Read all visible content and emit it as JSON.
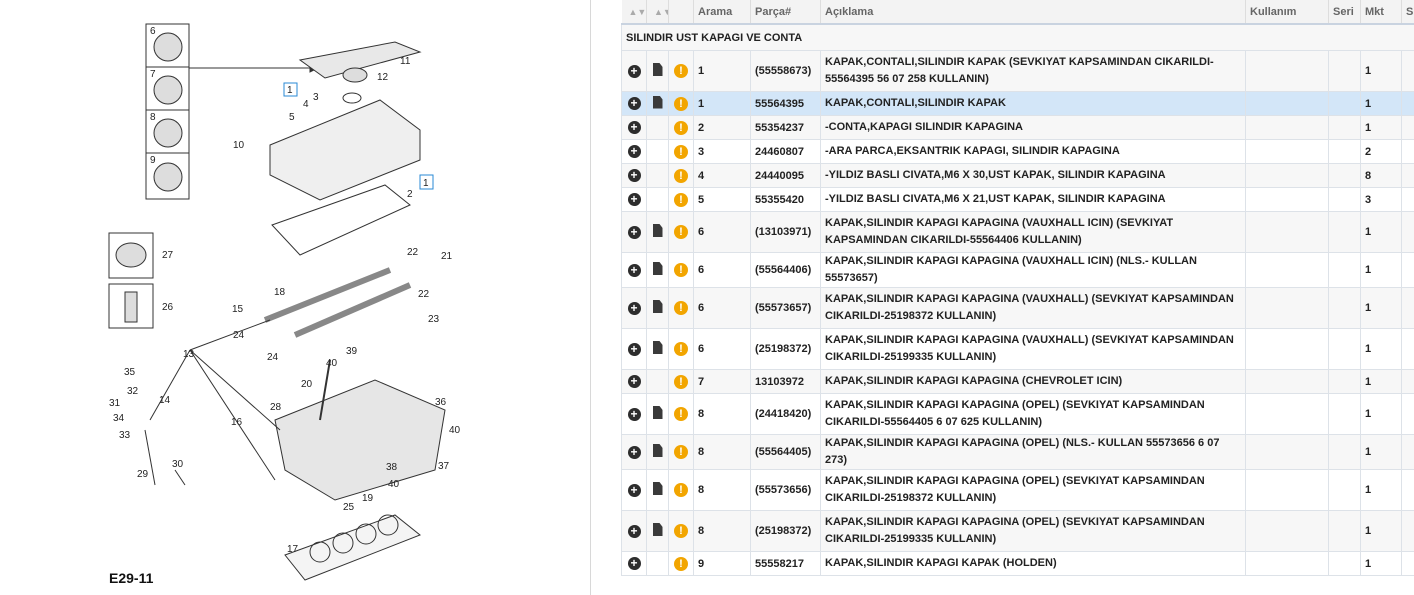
{
  "diagram": {
    "code": "E29-11",
    "callouts": [
      "1",
      "2",
      "3",
      "4",
      "5",
      "6",
      "7",
      "8",
      "9",
      "10",
      "11",
      "12",
      "13",
      "14",
      "15",
      "16",
      "17",
      "18",
      "19",
      "20",
      "21",
      "22",
      "22",
      "23",
      "24",
      "24",
      "25",
      "26",
      "27",
      "28",
      "29",
      "30",
      "31",
      "32",
      "33",
      "34",
      "35",
      "36",
      "37",
      "38",
      "39",
      "40",
      "40",
      "40",
      "1"
    ]
  },
  "table": {
    "headers": {
      "arama": "Arama",
      "parca": "Parça#",
      "aciklama": "Açıklama",
      "kullanim": "Kullanım",
      "seri": "Seri",
      "mkt": "Mkt",
      "s": "S"
    },
    "section_title": "SILINDIR UST KAPAGI VE CONTA",
    "rows": [
      {
        "arama": "1",
        "parca": "(55558673)",
        "aciklama": "KAPAK,CONTALI,SILINDIR KAPAK (SEVKIYAT KAPSAMINDAN CIKARILDI-55564395 56 07 258 KULLANIN)",
        "mkt": "1",
        "doc": true
      },
      {
        "arama": "1",
        "parca": "55564395",
        "aciklama": "KAPAK,CONTALI,SILINDIR KAPAK",
        "mkt": "1",
        "doc": true
      },
      {
        "arama": "2",
        "parca": "55354237",
        "aciklama": "-CONTA,KAPAGI SILINDIR KAPAGINA",
        "mkt": "1",
        "doc": false
      },
      {
        "arama": "3",
        "parca": "24460807",
        "aciklama": "-ARA PARCA,EKSANTRIK KAPAGI, SILINDIR KAPAGINA",
        "mkt": "2",
        "doc": false
      },
      {
        "arama": "4",
        "parca": "24440095",
        "aciklama": "-YILDIZ BASLI CIVATA,M6 X 30,UST KAPAK, SILINDIR KAPAGINA",
        "mkt": "8",
        "doc": false
      },
      {
        "arama": "5",
        "parca": "55355420",
        "aciklama": "-YILDIZ BASLI CIVATA,M6 X 21,UST KAPAK, SILINDIR KAPAGINA",
        "mkt": "3",
        "doc": false
      },
      {
        "arama": "6",
        "parca": "(13103971)",
        "aciklama": "KAPAK,SILINDIR KAPAGI KAPAGINA (VAUXHALL ICIN) (SEVKIYAT KAPSAMINDAN CIKARILDI-55564406 KULLANIN)",
        "mkt": "1",
        "doc": true
      },
      {
        "arama": "6",
        "parca": "(55564406)",
        "aciklama": "KAPAK,SILINDIR KAPAGI KAPAGINA (VAUXHALL ICIN) (NLS.- KULLAN 55573657)",
        "mkt": "1",
        "doc": true
      },
      {
        "arama": "6",
        "parca": "(55573657)",
        "aciklama": "KAPAK,SILINDIR KAPAGI KAPAGINA (VAUXHALL) (SEVKIYAT KAPSAMINDAN CIKARILDI-25198372 KULLANIN)",
        "mkt": "1",
        "doc": true
      },
      {
        "arama": "6",
        "parca": "(25198372)",
        "aciklama": "KAPAK,SILINDIR KAPAGI KAPAGINA (VAUXHALL) (SEVKIYAT KAPSAMINDAN CIKARILDI-25199335 KULLANIN)",
        "mkt": "1",
        "doc": true
      },
      {
        "arama": "7",
        "parca": "13103972",
        "aciklama": "KAPAK,SILINDIR KAPAGI KAPAGINA (CHEVROLET ICIN)",
        "mkt": "1",
        "doc": false
      },
      {
        "arama": "8",
        "parca": "(24418420)",
        "aciklama": "KAPAK,SILINDIR KAPAGI KAPAGINA (OPEL) (SEVKIYAT KAPSAMINDAN CIKARILDI-55564405 6 07 625 KULLANIN)",
        "mkt": "1",
        "doc": true
      },
      {
        "arama": "8",
        "parca": "(55564405)",
        "aciklama": "KAPAK,SILINDIR KAPAGI KAPAGINA (OPEL) (NLS.- KULLAN 55573656 6 07 273)",
        "mkt": "1",
        "doc": true
      },
      {
        "arama": "8",
        "parca": "(55573656)",
        "aciklama": "KAPAK,SILINDIR KAPAGI KAPAGINA (OPEL) (SEVKIYAT KAPSAMINDAN CIKARILDI-25198372 KULLANIN)",
        "mkt": "1",
        "doc": true
      },
      {
        "arama": "8",
        "parca": "(25198372)",
        "aciklama": "KAPAK,SILINDIR KAPAGI KAPAGINA (OPEL) (SEVKIYAT KAPSAMINDAN CIKARILDI-25199335 KULLANIN)",
        "mkt": "1",
        "doc": true
      },
      {
        "arama": "9",
        "parca": "55558217",
        "aciklama": "KAPAK,SILINDIR KAPAGI KAPAK (HOLDEN)",
        "mkt": "1",
        "doc": false
      }
    ],
    "highlight_color": "#d3e6f8",
    "warning_color": "#f2a500"
  },
  "icons": {
    "add": "plus-circle-icon",
    "document": "document-icon",
    "warning": "warning-icon",
    "sort": "sort-icon"
  }
}
